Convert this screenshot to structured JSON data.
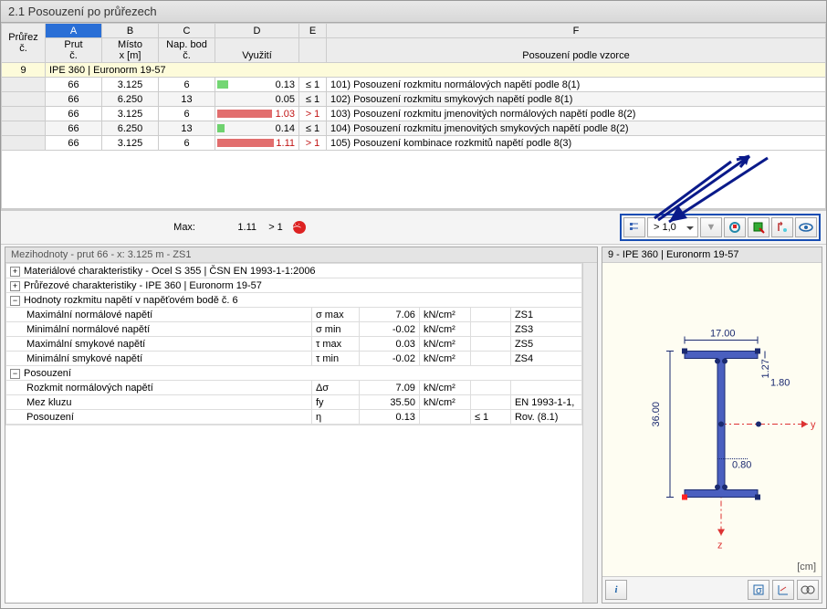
{
  "title": "2.1 Posouzení po průřezech",
  "columns": {
    "letters": [
      "A",
      "B",
      "C",
      "D",
      "E",
      "F"
    ],
    "row_label": [
      "Průřez",
      "č."
    ],
    "A": [
      "Prut",
      "č."
    ],
    "B": [
      "Místo",
      "x [m]"
    ],
    "C": [
      "Nap. bod",
      "č."
    ],
    "D": [
      "",
      "Využití"
    ],
    "E": [
      "",
      ""
    ],
    "F": [
      "",
      "Posouzení podle vzorce"
    ]
  },
  "group_row": {
    "id": "9",
    "text": "IPE 360 | Euronorm 19-57"
  },
  "rows": [
    {
      "prut": "66",
      "x": "3.125",
      "bod": "6",
      "util": "0.13",
      "rel": "≤ 1",
      "bar": 12,
      "barClass": "bar-g",
      "desc": "101) Posouzení rozkmitu normálových napětí podle 8(1)"
    },
    {
      "prut": "66",
      "x": "6.250",
      "bod": "13",
      "util": "0.05",
      "rel": "≤ 1",
      "bar": 0,
      "barClass": "bar-g",
      "striped": true,
      "desc": "102) Posouzení rozkmitu smykových napětí podle 8(1)"
    },
    {
      "prut": "66",
      "x": "3.125",
      "bod": "6",
      "util": "1.03",
      "rel": "> 1",
      "bar": 60,
      "barClass": "bar-r",
      "red": true,
      "desc": "103) Posouzení rozkmitu jmenovitých normálových napětí podle 8(2)"
    },
    {
      "prut": "66",
      "x": "6.250",
      "bod": "13",
      "util": "0.14",
      "rel": "≤ 1",
      "bar": 8,
      "barClass": "bar-g",
      "striped": true,
      "desc": "104) Posouzení rozkmitu jmenovitých smykových napětí podle 8(2)"
    },
    {
      "prut": "66",
      "x": "3.125",
      "bod": "6",
      "util": "1.11",
      "rel": "> 1",
      "bar": 62,
      "barClass": "bar-r",
      "red": true,
      "desc": "105) Posouzení kombinace rozkmitů napětí podle 8(3)"
    }
  ],
  "max": {
    "label": "Max:",
    "value": "1.11",
    "rel": "> 1"
  },
  "filter_select": "> 1,0",
  "left": {
    "title": "Mezihodnoty - prut 66 - x: 3.125 m - ZS1",
    "tree": [
      {
        "toggle": "+",
        "text": "Materiálové charakteristiky - Ocel S 355 | ČSN EN 1993-1-1:2006"
      },
      {
        "toggle": "+",
        "text": "Průřezové charakteristiky -  IPE 360 | Euronorm 19-57"
      },
      {
        "toggle": "−",
        "text": "Hodnoty rozkmitu napětí v napěťovém bodě č. 6"
      }
    ],
    "vals": [
      {
        "name": "Maximální normálové napětí",
        "sym": "σ max",
        "val": "7.06",
        "unit": "kN/cm²",
        "extra": "ZS1"
      },
      {
        "name": "Minimální normálové napětí",
        "sym": "σ min",
        "val": "-0.02",
        "unit": "kN/cm²",
        "extra": "ZS3"
      },
      {
        "name": "Maximální smykové napětí",
        "sym": "τ max",
        "val": "0.03",
        "unit": "kN/cm²",
        "extra": "ZS5"
      },
      {
        "name": "Minimální smykové napětí",
        "sym": "τ min",
        "val": "-0.02",
        "unit": "kN/cm²",
        "extra": "ZS4"
      }
    ],
    "tree2": [
      {
        "toggle": "−",
        "text": "Posouzení"
      }
    ],
    "vals2": [
      {
        "name": "Rozkmit normálových napětí",
        "sym": "Δσ",
        "val": "7.09",
        "unit": "kN/cm²",
        "extra": ""
      },
      {
        "name": "Mez kluzu",
        "sym": "fy",
        "val": "35.50",
        "unit": "kN/cm²",
        "extra": "EN 1993-1-1,"
      },
      {
        "name": "Posouzení",
        "sym": "η",
        "val": "0.13",
        "unit": "",
        "rel": "≤ 1",
        "extra": "Rov. (8.1)"
      }
    ]
  },
  "right": {
    "title": "9 - IPE 360 | Euronorm 19-57",
    "dims": {
      "b": "17.00",
      "h": "36.00",
      "tf": "1.27",
      "tw": "0.80",
      "r": "1.80"
    },
    "axes": {
      "y": "y",
      "z": "z"
    },
    "unit": "[cm]"
  }
}
